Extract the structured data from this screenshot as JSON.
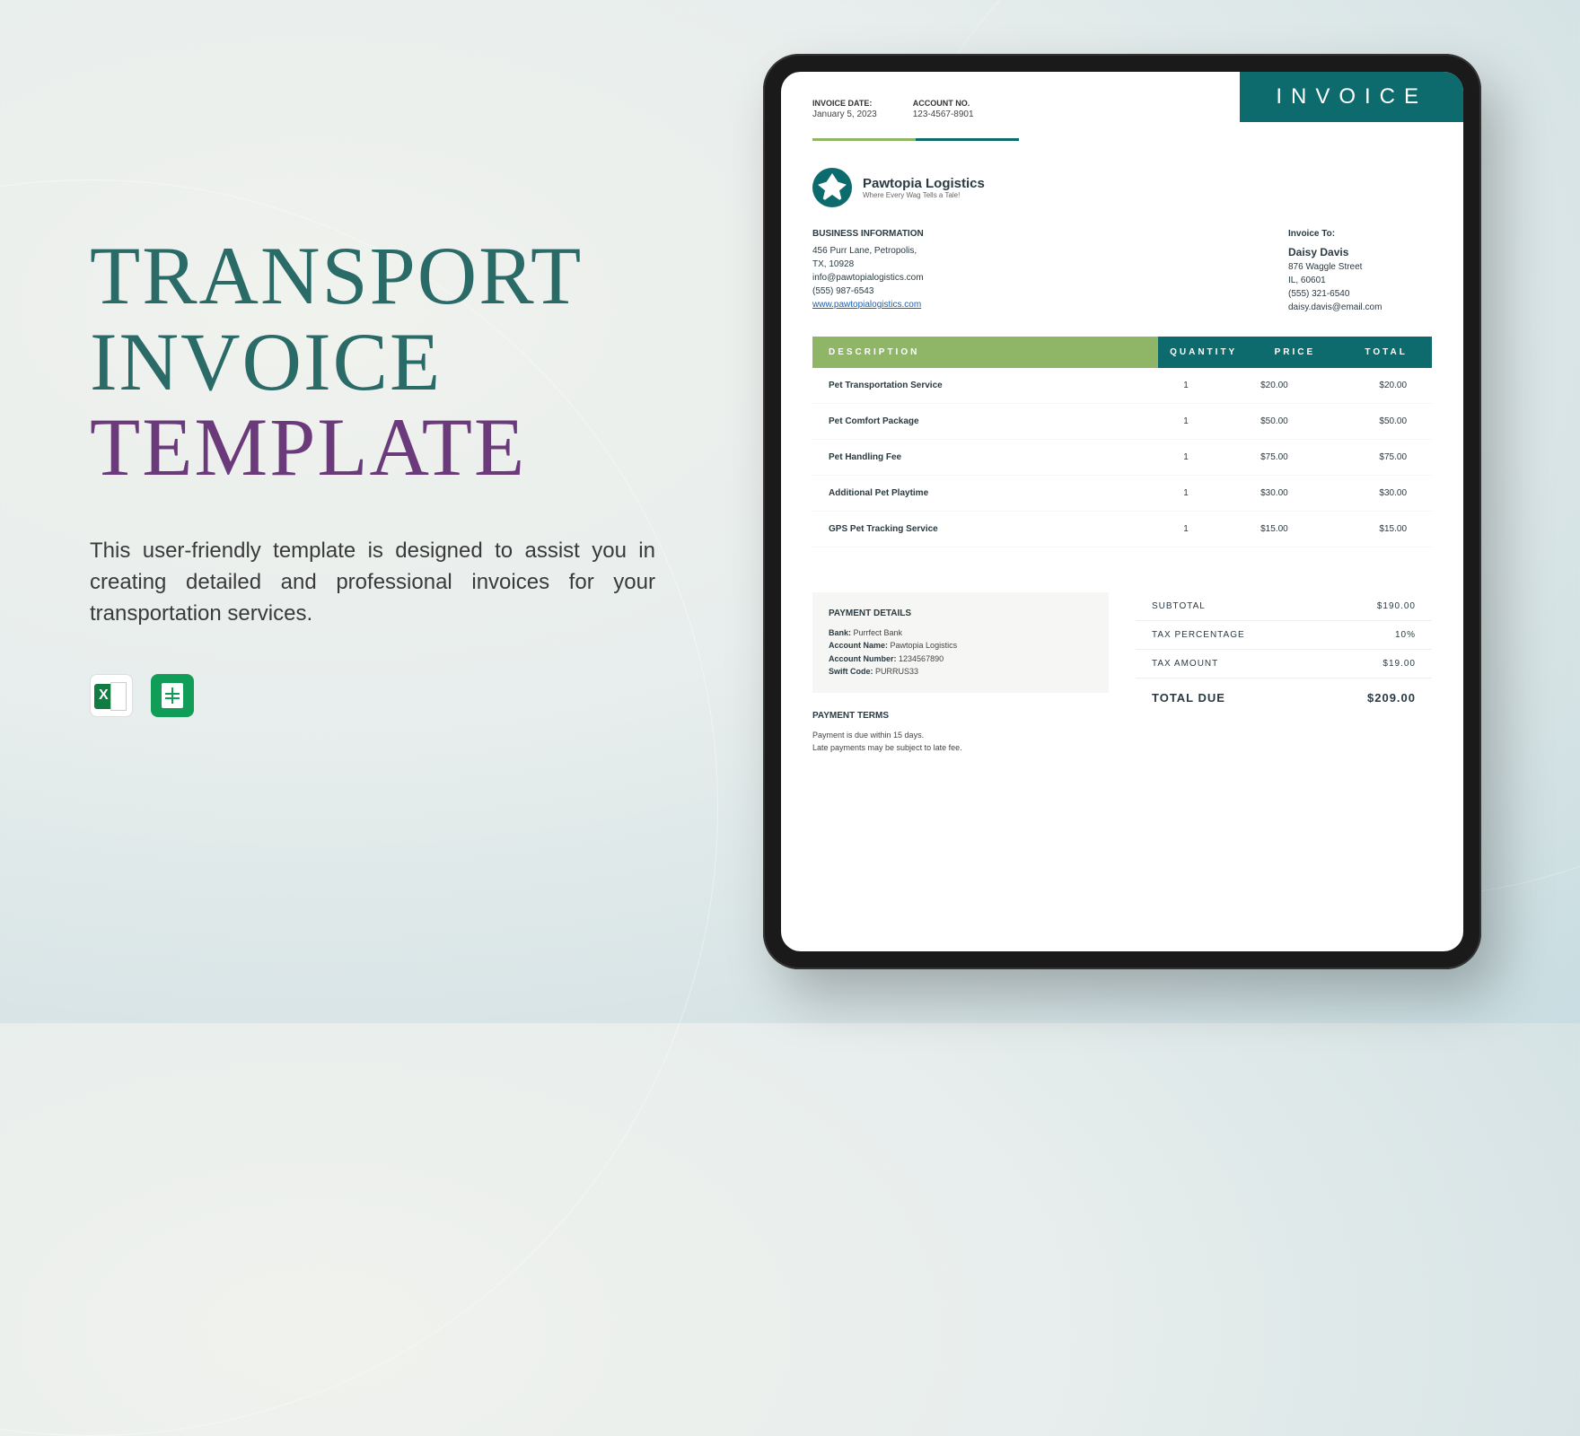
{
  "hero": {
    "line1": "TRANSPORT",
    "line2": "INVOICE",
    "line3": "TEMPLATE",
    "description": "This user-friendly template is designed to assist you in creating detailed and professional invoices for your transportation services."
  },
  "apps": {
    "excel": "Excel",
    "sheets": "Google Sheets"
  },
  "invoice": {
    "badge": "INVOICE",
    "meta": {
      "date_label": "INVOICE DATE:",
      "date_value": "January 5, 2023",
      "acct_label": "ACCOUNT NO.",
      "acct_value": "123-4567-8901"
    },
    "company": {
      "name": "Pawtopia Logistics",
      "tagline": "Where Every Wag Tells a Tale!"
    },
    "business": {
      "heading": "BUSINESS INFORMATION",
      "addr1": "456 Purr Lane, Petropolis,",
      "addr2": "TX, 10928",
      "email": "info@pawtopialogistics.com",
      "phone": "(555) 987-6543",
      "website": "www.pawtopialogistics.com"
    },
    "billto": {
      "heading": "Invoice To:",
      "name": "Daisy Davis",
      "addr1": "876 Waggle Street",
      "addr2": "IL, 60601",
      "phone": "(555) 321-6540",
      "email": "daisy.davis@email.com"
    },
    "columns": {
      "desc": "DESCRIPTION",
      "qty": "QUANTITY",
      "price": "PRICE",
      "total": "TOTAL"
    },
    "items": [
      {
        "desc": "Pet Transportation Service",
        "qty": "1",
        "price": "$20.00",
        "total": "$20.00"
      },
      {
        "desc": "Pet Comfort Package",
        "qty": "1",
        "price": "$50.00",
        "total": "$50.00"
      },
      {
        "desc": "Pet Handling Fee",
        "qty": "1",
        "price": "$75.00",
        "total": "$75.00"
      },
      {
        "desc": "Additional Pet Playtime",
        "qty": "1",
        "price": "$30.00",
        "total": "$30.00"
      },
      {
        "desc": "GPS Pet Tracking Service",
        "qty": "1",
        "price": "$15.00",
        "total": "$15.00"
      }
    ],
    "payment": {
      "title": "PAYMENT DETAILS",
      "bank_label": "Bank:",
      "bank_value": "Purrfect Bank",
      "acctname_label": "Account Name:",
      "acctname_value": "Pawtopia Logistics",
      "acctnum_label": "Account Number:",
      "acctnum_value": "1234567890",
      "swift_label": "Swift Code:",
      "swift_value": "PURRUS33"
    },
    "totals": {
      "subtotal_label": "SUBTOTAL",
      "subtotal_value": "$190.00",
      "taxpct_label": "TAX PERCENTAGE",
      "taxpct_value": "10%",
      "taxamt_label": "TAX AMOUNT",
      "taxamt_value": "$19.00",
      "due_label": "TOTAL DUE",
      "due_value": "$209.00"
    },
    "terms": {
      "title": "PAYMENT TERMS",
      "line1": "Payment is due within 15 days.",
      "line2": "Late payments may be subject to late fee."
    }
  }
}
